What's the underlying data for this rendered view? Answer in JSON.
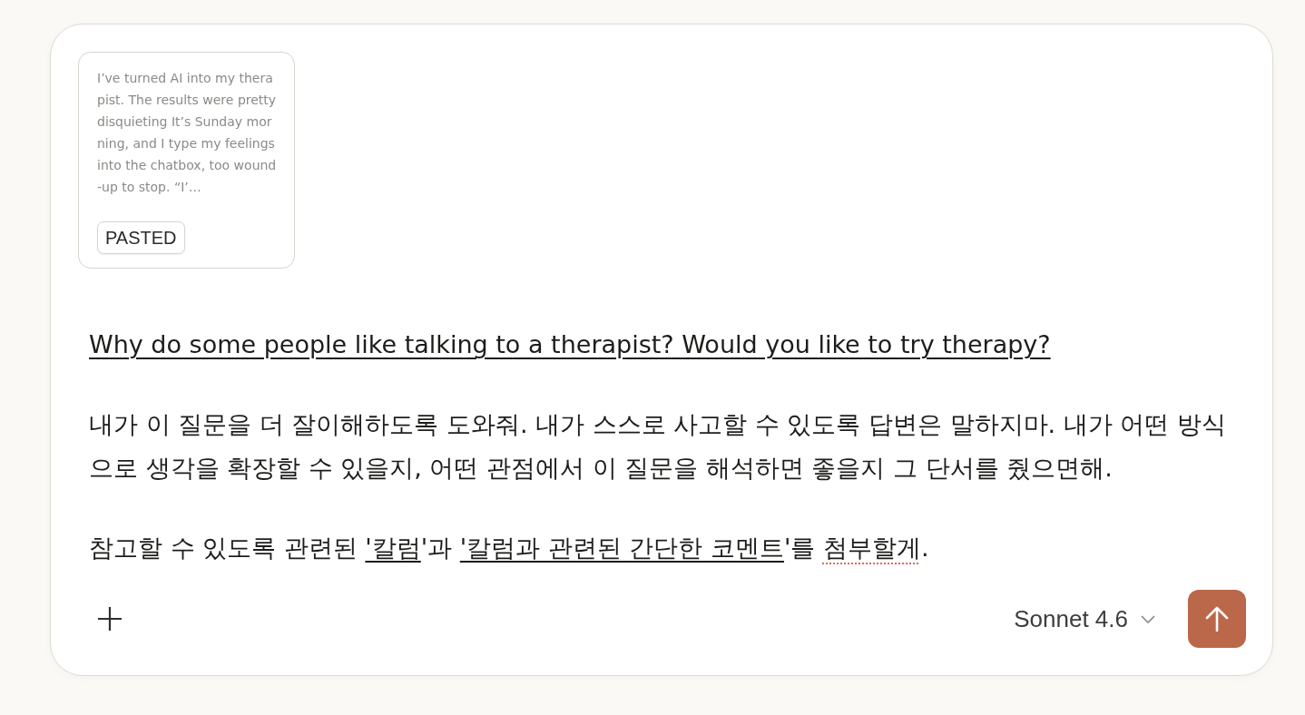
{
  "composer": {
    "attachments": [
      {
        "kind": "pasted",
        "preview": "I’ve turned AI into my therapist. The results were pretty disquieting It’s Sunday morning, and I type my feelings into the chatbox, too wound-up to stop. “I’…",
        "badge": "PASTED"
      }
    ],
    "message": {
      "paragraphs": [
        {
          "segments": [
            {
              "kind": "underlined",
              "text": "Why do some people like talking to a therapist? Would you like to try therapy?"
            }
          ]
        },
        {
          "segments": [
            {
              "kind": "plain",
              "text": "내가 이 질문을 더 잘이해하도록 도와줘. 내가 스스로 사고할 수 있도록 답변은 말하지마. 내가 어떤 방식으로 생각을 확장할 수 있을지, 어떤 관점에서 이 질문을 해석하면 좋을지 그 단서를 줬으면해."
            }
          ]
        },
        {
          "segments": [
            {
              "kind": "plain",
              "text": "참고할 수 있도록 관련된 "
            },
            {
              "kind": "underlined",
              "text": "'칼럼"
            },
            {
              "kind": "plain",
              "text": "'과 "
            },
            {
              "kind": "underlined",
              "text": "'칼럼과 관련된 간단한 코멘트"
            },
            {
              "kind": "plain",
              "text": "'를 "
            },
            {
              "kind": "misspelled",
              "text": "첨부할게"
            },
            {
              "kind": "plain",
              "text": "."
            }
          ]
        }
      ]
    },
    "model_selector": {
      "label": "Sonnet 4.6"
    }
  }
}
